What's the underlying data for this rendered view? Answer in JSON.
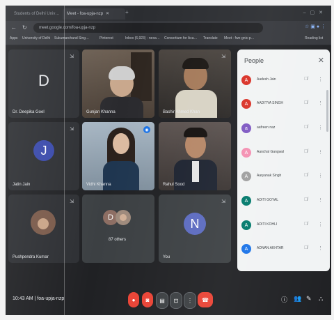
{
  "browser": {
    "tabs": [
      {
        "label": "Students of Delhi Univ…"
      },
      {
        "label": "Meet - foa-upja-nzp"
      }
    ],
    "url": "meet.google.com/foa-upja-nzp",
    "bookmarks": [
      "Apps",
      "University of Delhi",
      "Sukumarchand Sing…",
      "Pinterest",
      "Inbox (6,923) - nexa…",
      "Consortium for Aca…",
      "Translate",
      "Meet - fwe-gnic-p…",
      "Reading list"
    ]
  },
  "tiles": [
    {
      "name": "Dr. Deepika Goel",
      "initial": "D",
      "color": "#3c4043",
      "type": "initial"
    },
    {
      "name": "Gunjan Khanna",
      "type": "video"
    },
    {
      "name": "Bashir Ahmed Khan",
      "type": "video"
    },
    {
      "name": "Jatin Jain",
      "initial": "J",
      "color": "#3949ab",
      "type": "avatar"
    },
    {
      "name": "Vidhi Khanna",
      "type": "video"
    },
    {
      "name": "Rahul Sood",
      "type": "video"
    },
    {
      "name": "Pushpendra Kumar",
      "type": "photo"
    },
    {
      "name": "87 others",
      "initial": "D",
      "type": "others"
    },
    {
      "name": "You",
      "initial": "N",
      "color": "#5c6bc0",
      "type": "avatar"
    }
  ],
  "people_panel": {
    "title": "People",
    "members": [
      {
        "name": "Aadesh Jain",
        "initial": "A",
        "color": "#d93025"
      },
      {
        "name": "AADITYA SINGH",
        "initial": "A",
        "color": "#d93025"
      },
      {
        "name": "aafreen naz",
        "initial": "a",
        "color": "#7e57c2"
      },
      {
        "name": "Aanchal Gangwal",
        "initial": "A",
        "color": "#f48fb1"
      },
      {
        "name": "Aaryanak Singh",
        "initial": "A",
        "color": "#9e9e9e"
      },
      {
        "name": "ADITI GOYAL",
        "initial": "A",
        "color": "#00796b"
      },
      {
        "name": "ADITI KOHLI",
        "initial": "A",
        "color": "#00796b"
      },
      {
        "name": "ADNAN AKHTAR",
        "initial": "A",
        "color": "#1a73e8"
      }
    ]
  },
  "bottom_bar": {
    "time": "10:43 AM",
    "meeting_code": "foa-upja-nzp"
  },
  "colors": {
    "end_call": "#ea4335",
    "mic_off": "#ea4335",
    "control": "#3c4043"
  }
}
